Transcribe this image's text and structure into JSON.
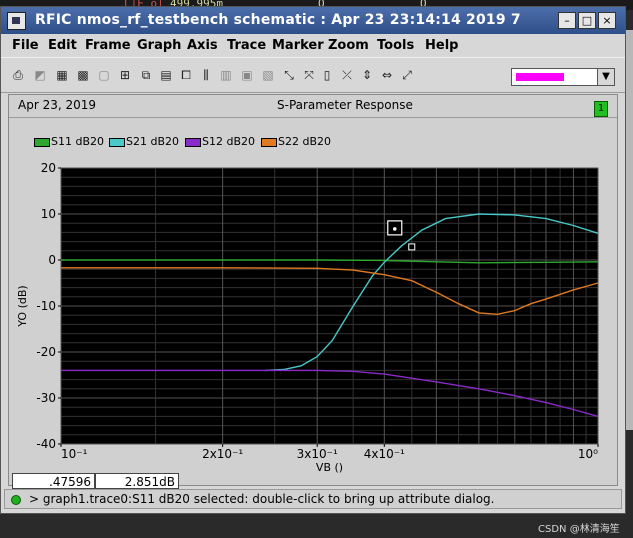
{
  "background": {
    "texts": [
      "L|E o|",
      "499.995m",
      "O",
      "O"
    ]
  },
  "window": {
    "title": "RFIC nmos_rf_testbench schematic : Apr 23 23:14:14 2019 7",
    "controls": [
      "–",
      "□",
      "×"
    ]
  },
  "menu": [
    "File",
    "Edit",
    "Frame",
    "Graph",
    "Axis",
    "Trace",
    "Marker",
    "Zoom",
    "Tools",
    "Help"
  ],
  "toolbar": {
    "icons": [
      "printer-icon",
      "graph-icon",
      "grid-icon",
      "grid-dense-icon",
      "blank-icon",
      "frame-icon",
      "copy-icon",
      "strip-icon",
      "layout-icon",
      "bars-icon",
      "ruler-icon",
      "table-icon",
      "select-icon",
      "pointer-icon",
      "calculator-icon",
      "cross-icon",
      "split-horizontal-icon",
      "split-vertical-icon",
      "fit-icon"
    ],
    "selected_color": "#ff00ff"
  },
  "chart_header": {
    "date": "Apr 23, 2019",
    "title": "S-Parameter Response",
    "badge": "1"
  },
  "chart_data": {
    "type": "line",
    "title": "S-Parameter Response",
    "xlabel": "VB ()",
    "ylabel": "YO (dB)",
    "xscale": "log",
    "xlim": [
      0.1,
      1.0
    ],
    "ylim": [
      -40,
      20
    ],
    "yticks": [
      "20",
      "10",
      "0",
      "-10",
      "-20",
      "-30",
      "-40"
    ],
    "xticks": [
      {
        "value": 0.1,
        "label": "10⁻¹"
      },
      {
        "value": 0.2,
        "label": "2x10⁻¹"
      },
      {
        "value": 0.3,
        "label": "3x10⁻¹"
      },
      {
        "value": 0.4,
        "label": "4x10⁻¹"
      },
      {
        "value": 1.0,
        "label": "10⁰"
      }
    ],
    "grid": true,
    "legend_position": "top-left",
    "series": [
      {
        "name": "S11 dB20",
        "color": "#2fa82f",
        "x": [
          0.1,
          0.3,
          0.4,
          0.5,
          0.6,
          0.8,
          1.0
        ],
        "y": [
          0,
          0,
          -0.1,
          -0.4,
          -0.6,
          -0.5,
          -0.4
        ]
      },
      {
        "name": "S21 dB20",
        "color": "#49c8c8",
        "x": [
          0.24,
          0.26,
          0.28,
          0.3,
          0.32,
          0.35,
          0.38,
          0.4,
          0.43,
          0.47,
          0.52,
          0.6,
          0.7,
          0.8,
          0.9,
          1.0
        ],
        "y": [
          -24,
          -23.8,
          -23,
          -21,
          -17.5,
          -10,
          -3.5,
          -0.5,
          3,
          6.5,
          9,
          10,
          9.8,
          9,
          7.5,
          5.8
        ]
      },
      {
        "name": "S12 dB20",
        "color": "#8a2ac8",
        "x": [
          0.1,
          0.2,
          0.3,
          0.35,
          0.4,
          0.5,
          0.6,
          0.7,
          0.8,
          0.9,
          1.0
        ],
        "y": [
          -24,
          -24,
          -24,
          -24.2,
          -24.8,
          -26.5,
          -28,
          -29.5,
          -31,
          -32.5,
          -34
        ]
      },
      {
        "name": "S22 dB20",
        "color": "#e07a20",
        "x": [
          0.1,
          0.2,
          0.3,
          0.35,
          0.4,
          0.45,
          0.5,
          0.55,
          0.6,
          0.65,
          0.7,
          0.75,
          0.8,
          0.9,
          1.0
        ],
        "y": [
          -1.7,
          -1.7,
          -1.8,
          -2.2,
          -3.2,
          -4.5,
          -7,
          -9.5,
          -11.5,
          -11.8,
          -11,
          -9.5,
          -8.5,
          -6.5,
          -5
        ]
      }
    ]
  },
  "marker": {
    "x": 0.45,
    "y": 2.85
  },
  "readouts": {
    "x": ".47596",
    "y": "2.851dB"
  },
  "status": {
    "text": "> graph1.trace0:S11 dB20 selected: double-click to bring up attribute dialog."
  },
  "watermark": "CSDN @林清海笙"
}
